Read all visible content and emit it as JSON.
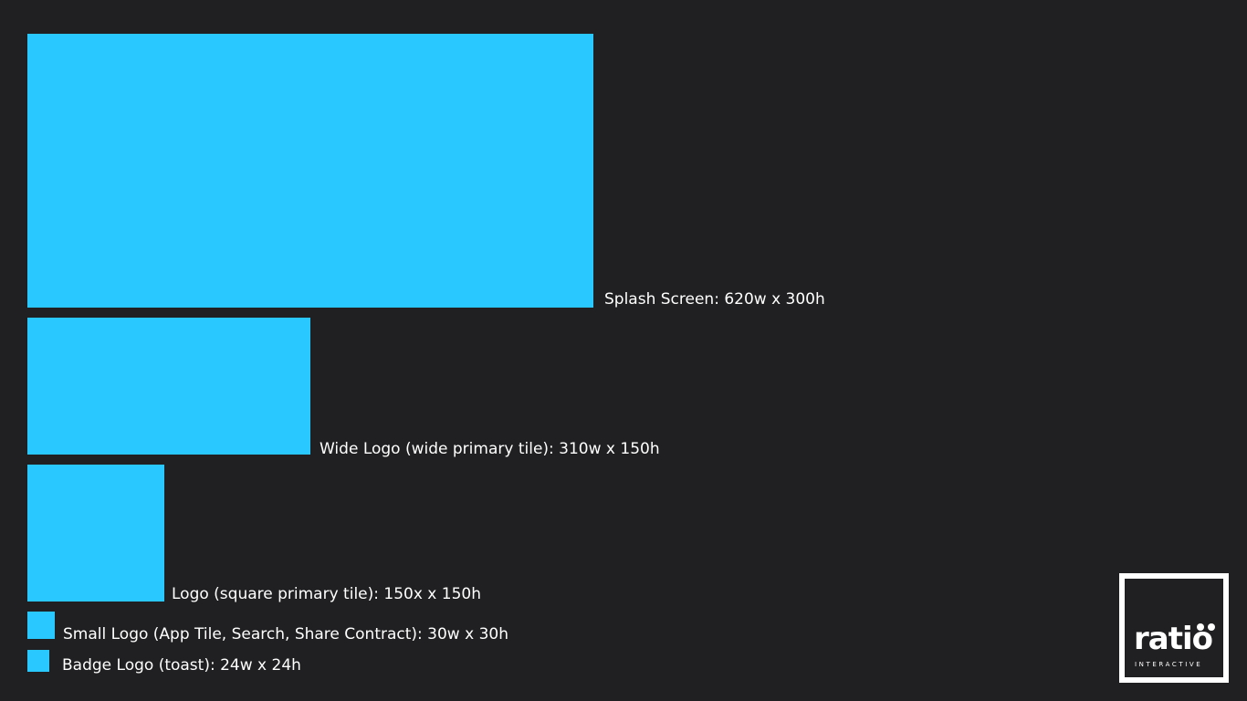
{
  "colors": {
    "background": "#201f21",
    "tile": "#29c8ff",
    "text": "#ffffff"
  },
  "items": [
    {
      "label": "Splash Screen: 620w x 300h"
    },
    {
      "label": "Wide Logo (wide primary tile): 310w x 150h"
    },
    {
      "label": "Logo (square primary tile): 150x x 150h"
    },
    {
      "label": "Small Logo (App Tile, Search, Share Contract): 30w x 30h"
    },
    {
      "label": "Badge Logo (toast): 24w x 24h"
    }
  ],
  "brand": {
    "wordmark": "ratio",
    "tagline": "INTERACTIVE"
  }
}
